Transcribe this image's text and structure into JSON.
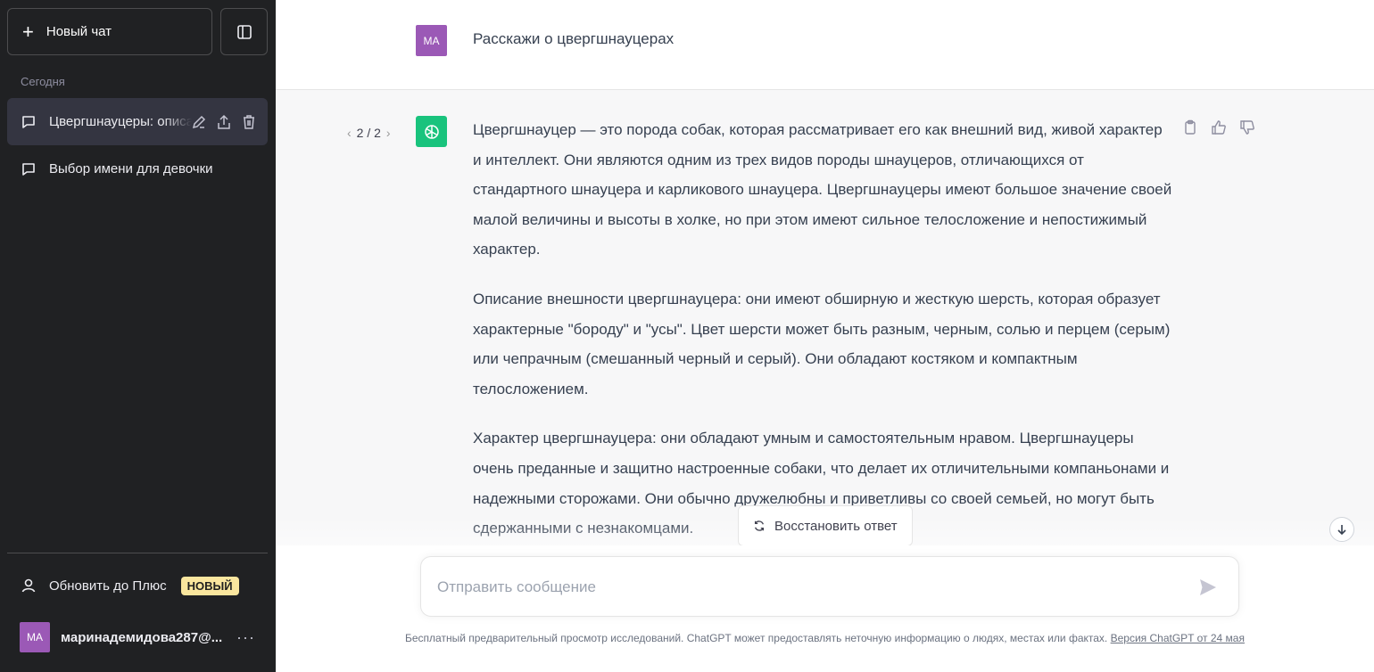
{
  "sidebar": {
    "new_chat_label": "Новый чат",
    "section_today": "Сегодня",
    "chats": [
      {
        "title": "Цвергшнауцеры: описание"
      },
      {
        "title": "Выбор имени для девочки"
      }
    ],
    "upgrade_label": "Обновить до Плюс",
    "upgrade_badge": "НОВЫЙ",
    "user_initials": "MA",
    "user_name": "маринадемидова287@...",
    "more_label": "···"
  },
  "conversation": {
    "user_initials": "MA",
    "user_message": "Расскажи о цвергшнауцерах",
    "pager": "2 / 2",
    "pager_prev": "‹",
    "pager_next": "›",
    "answer_paragraphs": [
      "Цвергшнауцер — это порода собак, которая рассматривает его как внешний вид, живой характер и интеллект. Они являются одним из трех видов породы шнауцеров, отличающихся от стандартного шнауцера и карликового шнауцера. Цвергшнауцеры имеют большое значение своей малой величины и высоты в холке, но при этом имеют сильное телосложение и непостижимый характер.",
      "Описание внешности цвергшнауцера: они имеют обширную и жесткую шерсть, которая образует характерные \"бороду\" и \"усы\". Цвет шерсти может быть разным, черным, солью и перцем (серым) или чепрачным (смешанный черный и серый). Они обладают костяком и компактным телосложением.",
      "Характер цвергшнауцера: они обладают умным и самостоятельным нравом. Цвергшнауцеры очень преданные и защитно настроенные собаки, что делает их отличительными компаньонами и надежными сторожами. Они обычно дружелюбны и приветливы со своей семьей, но могут быть сдержанными с незнакомцами."
    ],
    "regenerate_label": "Восстановить ответ"
  },
  "composer": {
    "placeholder": "Отправить сообщение"
  },
  "footer": {
    "disclaimer": "Бесплатный предварительный просмотр исследований. ChatGPT может предоставлять неточную информацию о людях, местах или фактах. ",
    "version_link": "Версия ChatGPT от 24 мая"
  },
  "colors": {
    "sidebar_bg": "#202123",
    "active_chat_bg": "#343541",
    "gpt_green": "#19c37d",
    "avatar_purple": "#9b59b6",
    "badge_yellow": "#fae69e"
  }
}
